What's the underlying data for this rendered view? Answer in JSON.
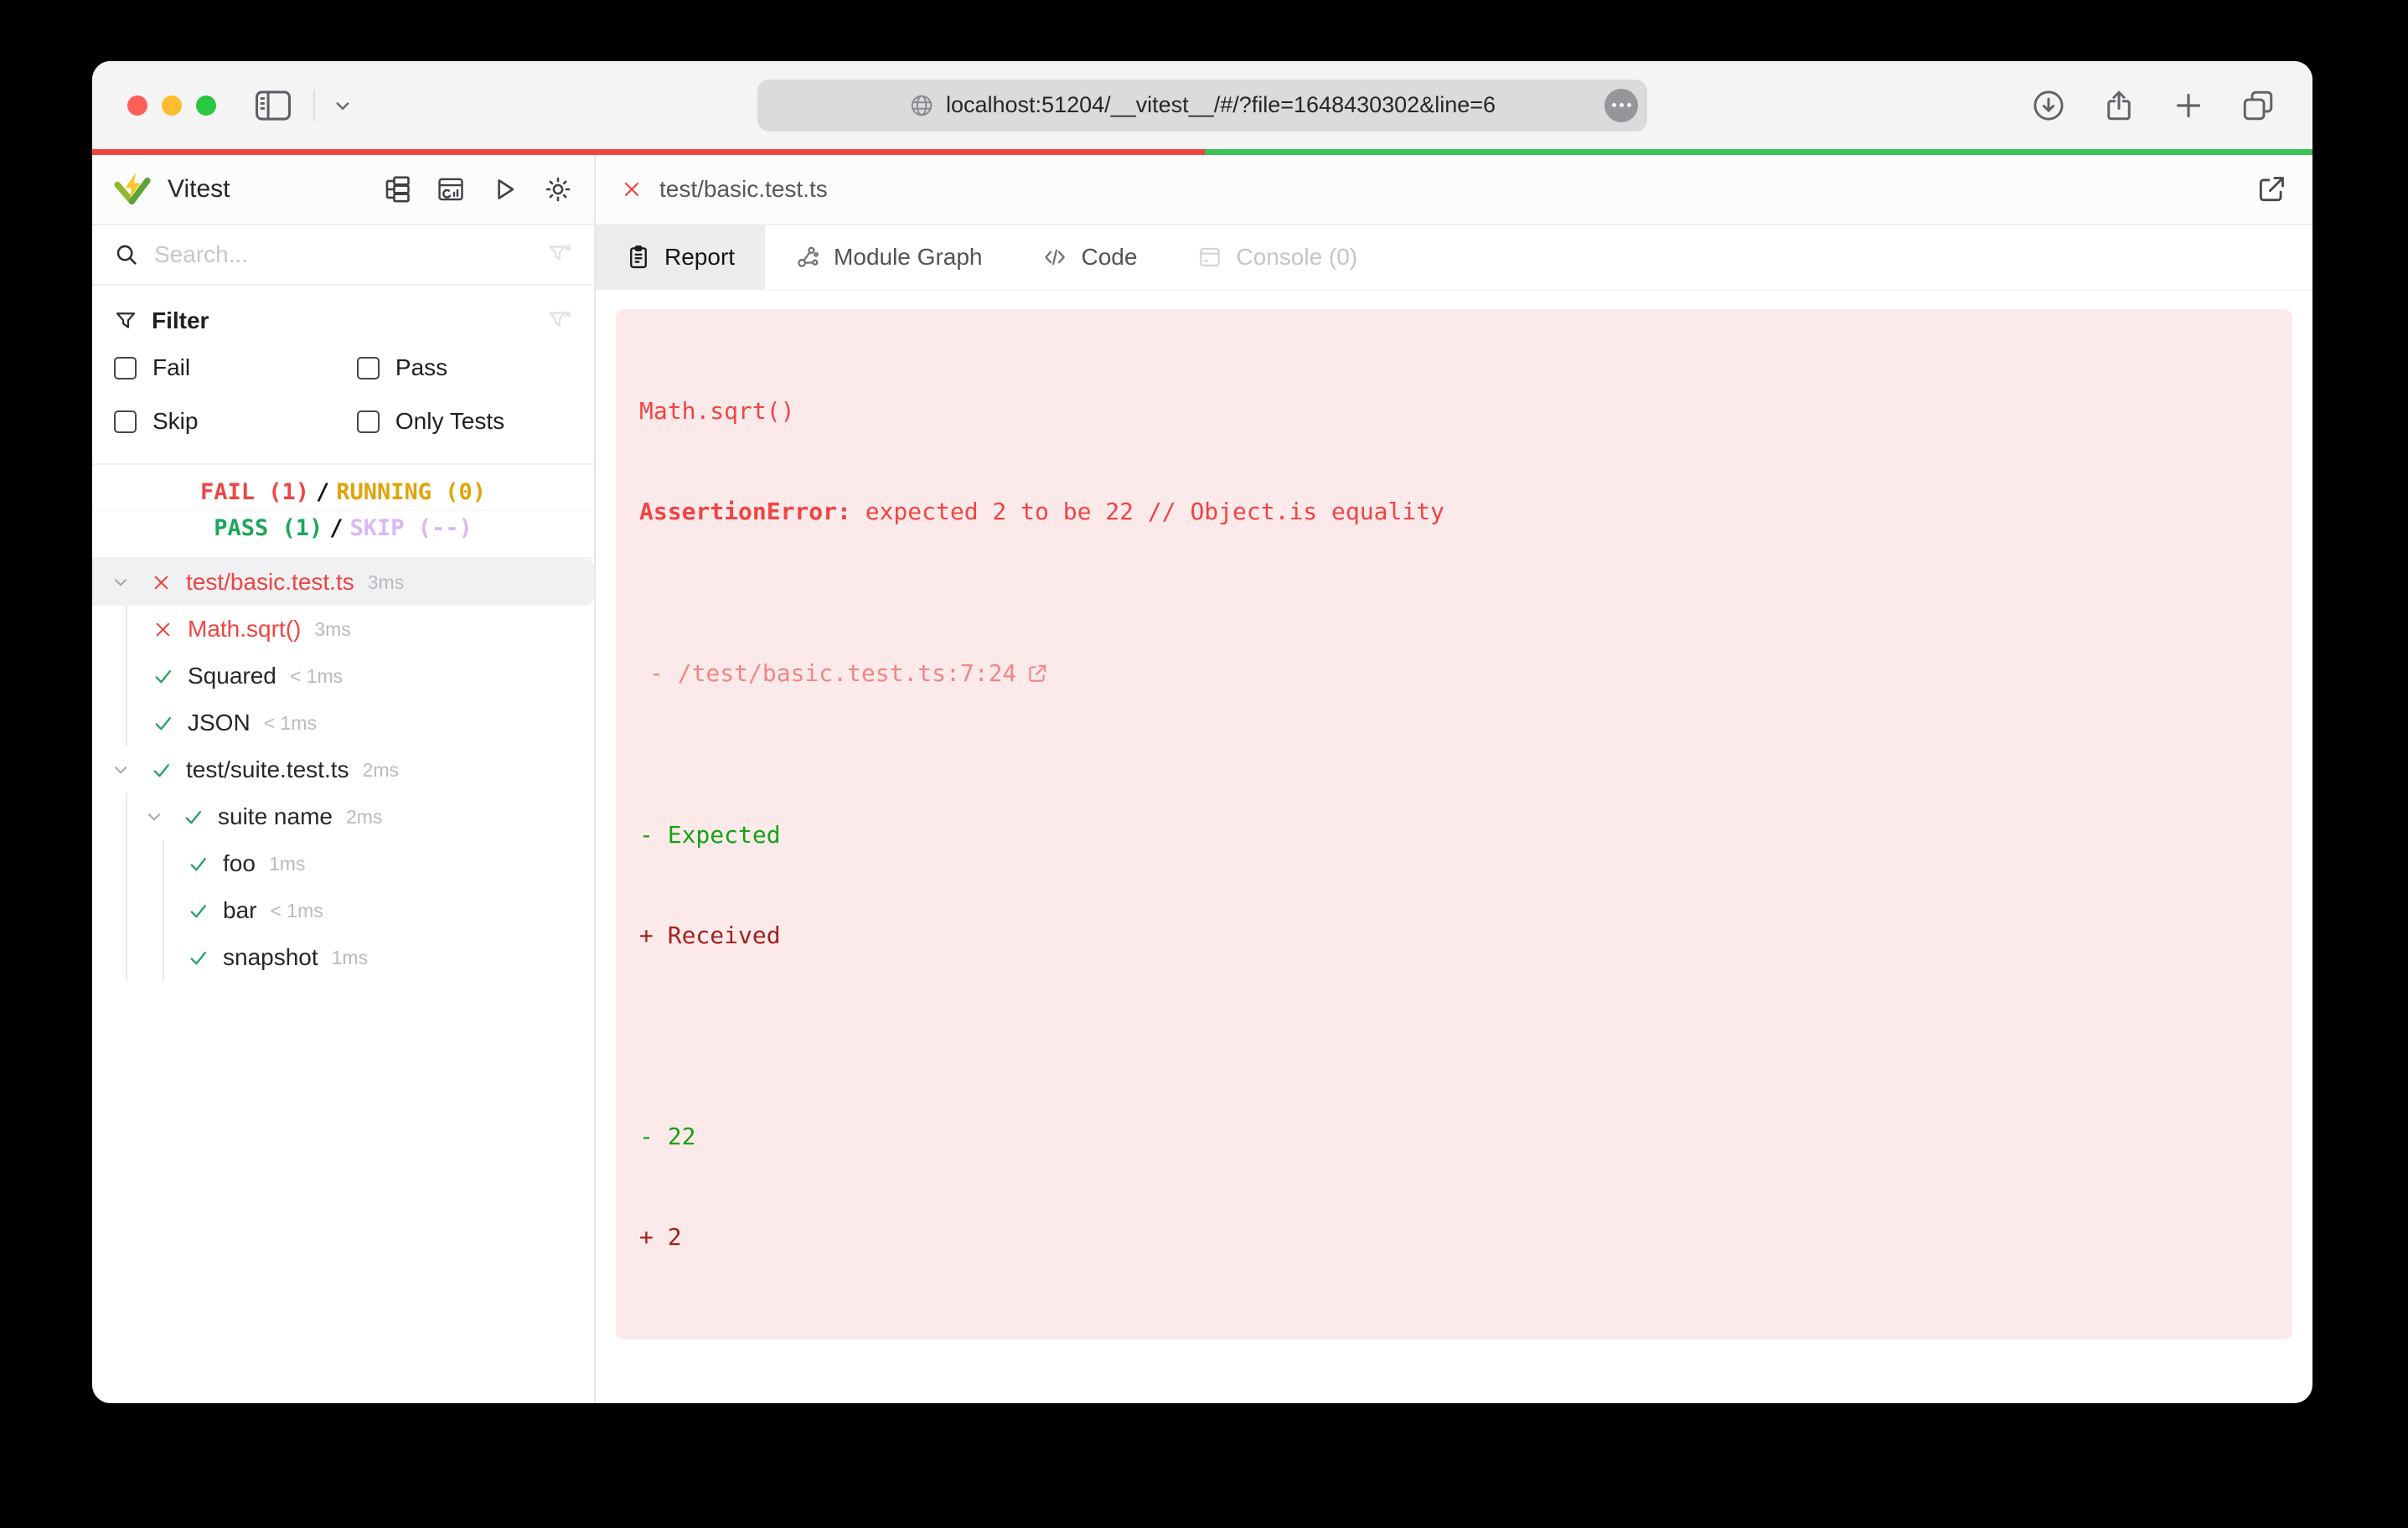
{
  "browser": {
    "url": "localhost:51204/__vitest__/#/?file=1648430302&line=6",
    "traffic_lights": {
      "close": "#ff5f57",
      "minimize": "#febc2e",
      "zoom": "#28c840"
    }
  },
  "progress": {
    "fail_color": "#ee4444",
    "pass_color": "#38c453",
    "fail_width": "50.1%"
  },
  "sidebar": {
    "title": "Vitest",
    "search_placeholder": "Search...",
    "filter_title": "Filter",
    "filter_options": [
      {
        "label": "Fail",
        "checked": false
      },
      {
        "label": "Pass",
        "checked": false
      },
      {
        "label": "Skip",
        "checked": false
      },
      {
        "label": "Only Tests",
        "checked": false
      }
    ],
    "summary": {
      "fail": "FAIL (1)",
      "running": "RUNNING (0)",
      "pass": "PASS (1)",
      "skip": "SKIP (--)",
      "separator": "/",
      "colors": {
        "fail": "#f04444",
        "running": "#dfa408",
        "pass": "#1da65a",
        "skip": "#d9b8f8"
      }
    },
    "tree": [
      {
        "label": "test/basic.test.ts",
        "duration": "3ms",
        "status": "fail",
        "selected": true
      },
      {
        "label": "Math.sqrt()",
        "duration": "3ms",
        "status": "fail"
      },
      {
        "label": "Squared",
        "duration": "< 1ms",
        "status": "pass"
      },
      {
        "label": "JSON",
        "duration": "< 1ms",
        "status": "pass"
      },
      {
        "label": "test/suite.test.ts",
        "duration": "2ms",
        "status": "pass"
      },
      {
        "label": "suite name",
        "duration": "2ms",
        "status": "pass"
      },
      {
        "label": "foo",
        "duration": "1ms",
        "status": "pass"
      },
      {
        "label": "bar",
        "duration": "< 1ms",
        "status": "pass"
      },
      {
        "label": "snapshot",
        "duration": "1ms",
        "status": "pass"
      }
    ]
  },
  "main": {
    "file_tab_label": "test/basic.test.ts",
    "tabs": [
      {
        "label": "Report",
        "active": true
      },
      {
        "label": "Module Graph",
        "active": false
      },
      {
        "label": "Code",
        "active": false
      },
      {
        "label": "Console (0)",
        "active": false,
        "disabled": true
      }
    ],
    "report": {
      "test_name": "Math.sqrt()",
      "error_name": "AssertionError: ",
      "error_message": "expected 2 to be 22 // Object.is equality",
      "stack_line": "- /test/basic.test.ts:7:24",
      "diff_expected": "- Expected",
      "diff_received": "+ Received",
      "diff_line_expected": "- 22",
      "diff_line_received": "+ 2"
    }
  }
}
